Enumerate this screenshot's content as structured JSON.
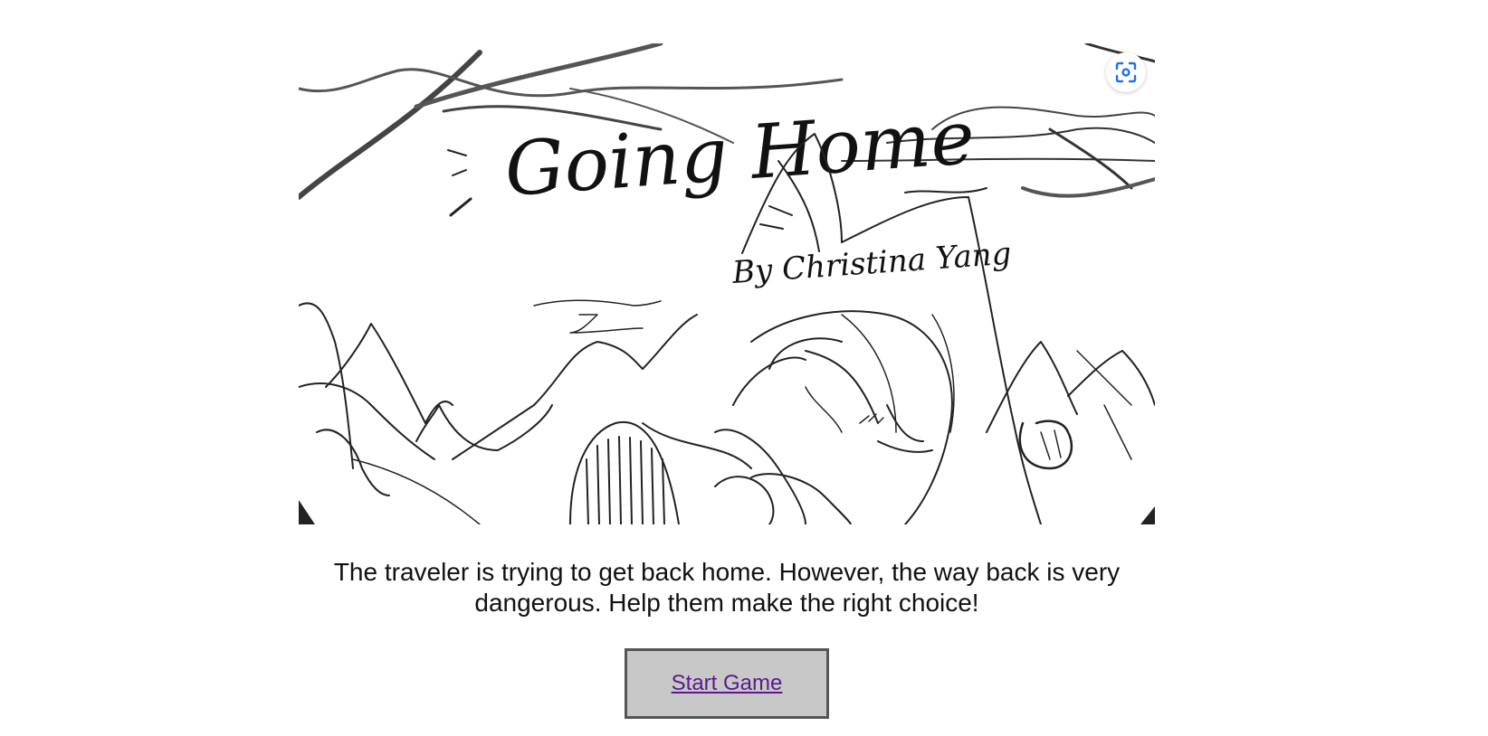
{
  "artwork": {
    "handwritten_title": "Going Home",
    "handwritten_byline": "By Christina Yang"
  },
  "icons": {
    "visual_search": "lens-scan-icon"
  },
  "intro": {
    "text": "The traveler is trying to get back home. However, the way back is very dangerous. Help them make the right choice!"
  },
  "start": {
    "label": "Start Game"
  },
  "colors": {
    "link": "#5a1a8c",
    "button_bg": "#c8c8c8",
    "button_border": "#555555",
    "lens_icon": "#1a73e8"
  }
}
